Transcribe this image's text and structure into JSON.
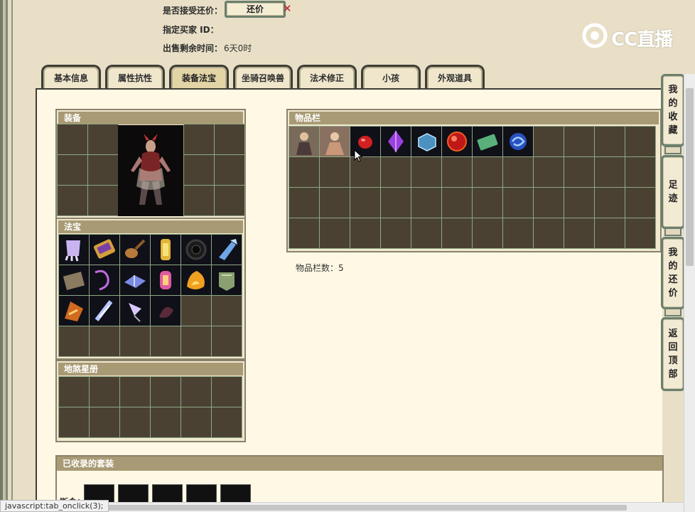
{
  "info": {
    "accept_counter_label": "是否接受还价：",
    "counter_button": "还价",
    "buyer_id_label": "指定买家 ID：",
    "time_left_label": "出售剩余时间：",
    "time_left_value": "6天0时"
  },
  "logo": {
    "text": "CC直播"
  },
  "tabs": [
    {
      "label": "基本信息"
    },
    {
      "label": "属性抗性"
    },
    {
      "label": "装备法宝"
    },
    {
      "label": "坐骑召唤兽"
    },
    {
      "label": "法术修正"
    },
    {
      "label": "小孩"
    },
    {
      "label": "外观道具"
    }
  ],
  "active_tab": "装备法宝",
  "panels": {
    "equipment": "装备",
    "fabao": "法宝",
    "disha": "地煞星册",
    "inventory": "物品栏",
    "suits": "已收录的套装"
  },
  "inventory_count": {
    "label": "物品栏数：",
    "value": "5"
  },
  "suits_label": "斯食：",
  "sidebar": {
    "favorites": [
      "我",
      "的",
      "收",
      "藏"
    ],
    "footprints": [
      "足",
      "迹"
    ],
    "my_counters": [
      "我",
      "的",
      "还",
      "价"
    ],
    "back_top": [
      "返",
      "回",
      "顶",
      "部"
    ]
  },
  "status_bar": "javascript:tab_onclick(3);",
  "icons": {
    "fabao": [
      "claw-icon",
      "scroll-icon",
      "pipa-icon",
      "lantern-icon",
      "ring-icon",
      "gauntlet-icon",
      "book-icon",
      "whip-icon",
      "tome-icon",
      "lamp-icon",
      "flame-icon",
      "shield-icon",
      "bell-icon",
      "bone-icon",
      "feather-icon",
      "shadow-icon"
    ],
    "inventory": [
      "warrior-portrait-icon",
      "monk-portrait-icon",
      "red-gem-icon",
      "purple-crystal-icon",
      "ice-cube-icon",
      "ruby-orb-icon",
      "jade-card-icon",
      "blue-swirl-icon"
    ]
  },
  "colors": {
    "panel_head": "#a89a74",
    "slot": "#4a4133",
    "slot_border": "#8ea883",
    "frame": "#6b7f6d"
  }
}
